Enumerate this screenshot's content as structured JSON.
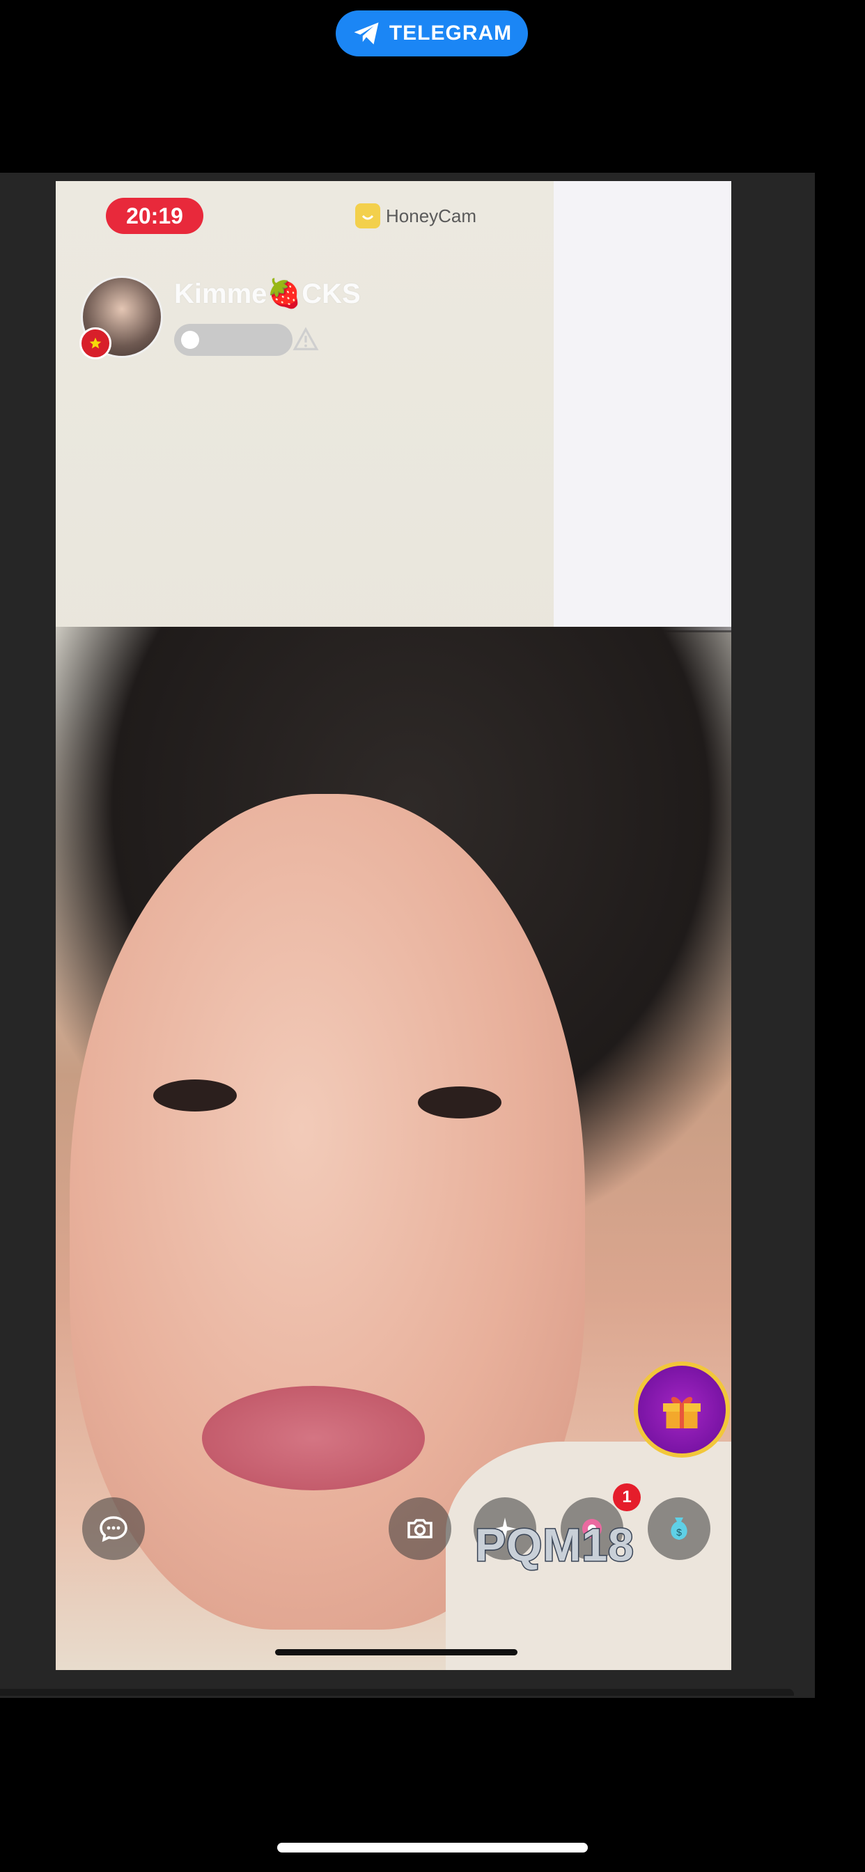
{
  "top_bar": {
    "app_label": "TELEGRAM",
    "icon": "paper-plane-icon",
    "accent": "#1b86f5"
  },
  "stream": {
    "timer": "20:19",
    "brand": "HoneyCam",
    "streamer_name_before": "Kimme",
    "streamer_name_emoji": "🍓",
    "streamer_name_after": "CKS",
    "watermark": "PQM18",
    "notification_count": "1",
    "timer_color": "#e8293b"
  },
  "controls": {
    "chat": "chat-bubble-icon",
    "camera": "camera-icon",
    "sparkle": "sparkle-icon",
    "beauty": "beauty-icon",
    "money": "money-bag-icon",
    "gift": "gift-icon"
  }
}
